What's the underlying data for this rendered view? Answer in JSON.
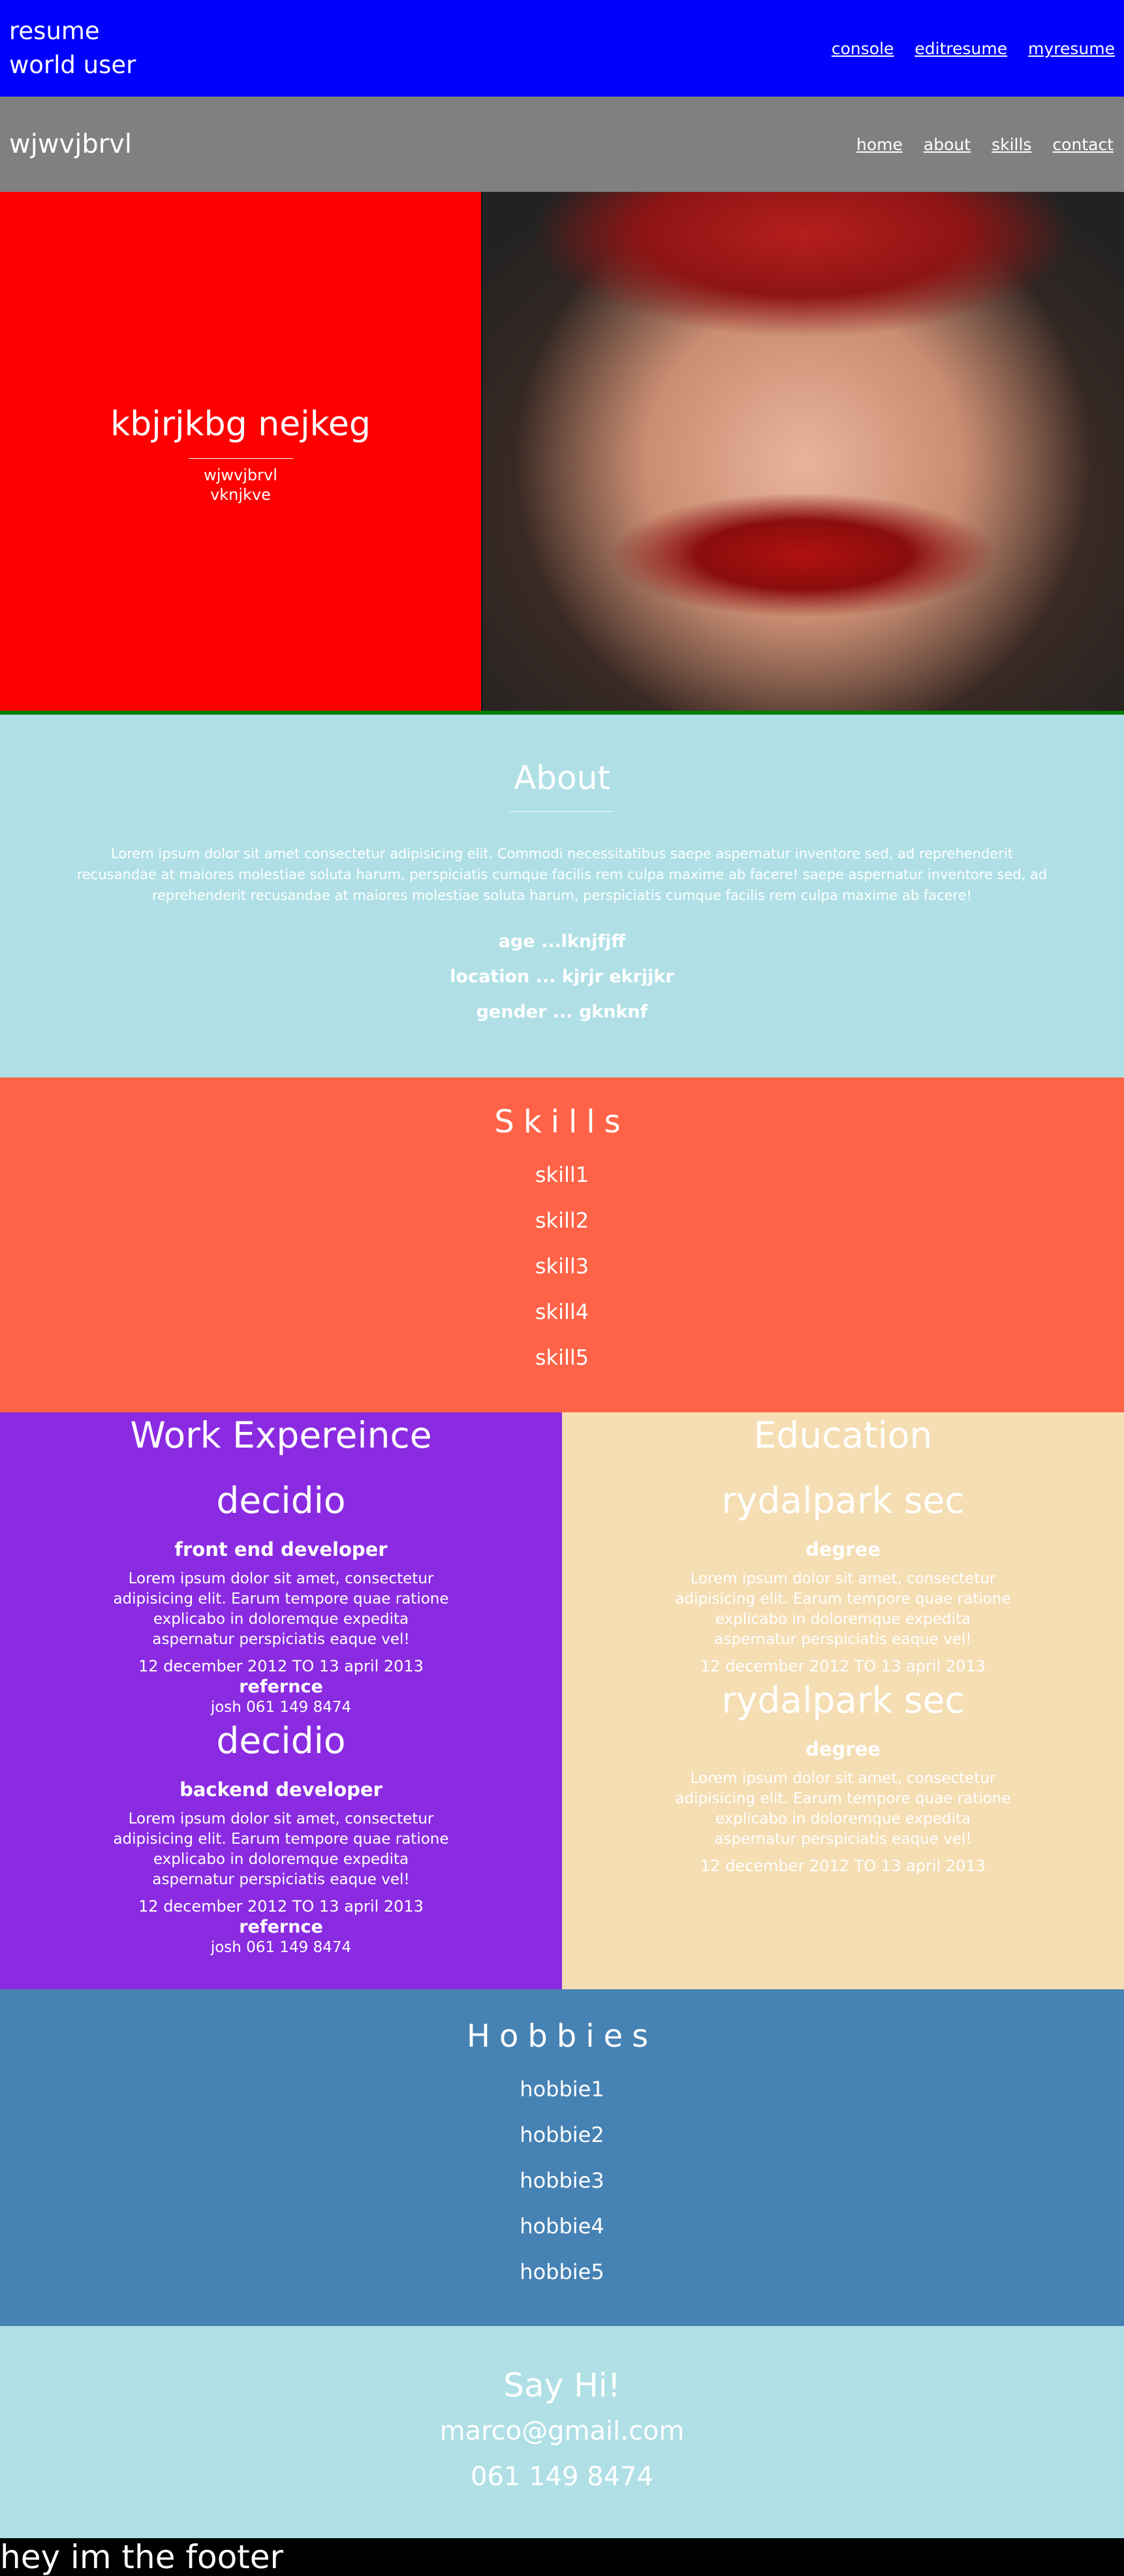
{
  "topbar": {
    "brand_line1": "resume",
    "brand_line2": "world user",
    "links": [
      "console",
      "editresume",
      "myresume"
    ]
  },
  "navbar": {
    "brand": "wjwvjbrvl",
    "links": [
      "home",
      "about",
      "skills",
      "contact"
    ]
  },
  "hero": {
    "name": "kbjrjkbg nejkeg",
    "subtitle_line1": "wjwvjbrvl",
    "subtitle_line2": "vknjkve"
  },
  "about": {
    "title": "About",
    "paragraph": "Lorem ipsum dolor sit amet consectetur adipisicing elit. Commodi necessitatibus saepe aspernatur inventore sed, ad reprehenderit recusandae at maiores molestiae soluta harum, perspiciatis cumque facilis rem culpa maxime ab facere! saepe aspernatur inventore sed, ad reprehenderit recusandae at maiores molestiae soluta harum, perspiciatis cumque facilis rem culpa maxime ab facere!",
    "facts": [
      "age ...lknjfjff",
      "location ... kjrjr ekrjjkr",
      "gender ... gknknf"
    ]
  },
  "skills": {
    "title": "Skills",
    "items": [
      "skill1",
      "skill2",
      "skill3",
      "skill4",
      "skill5"
    ]
  },
  "work": {
    "title": "Work Expereince",
    "entries": [
      {
        "org": "decidio",
        "role": "front end developer",
        "desc": "Lorem ipsum dolor sit amet, consectetur adipisicing elit. Earum tempore quae ratione explicabo in doloremque expedita aspernatur perspiciatis eaque vel!",
        "dates": "12 december 2012 TO 13 april 2013",
        "ref_label": "refernce",
        "ref": "josh 061 149 8474"
      },
      {
        "org": "decidio",
        "role": "backend developer",
        "desc": "Lorem ipsum dolor sit amet, consectetur adipisicing elit. Earum tempore quae ratione explicabo in doloremque expedita aspernatur perspiciatis eaque vel!",
        "dates": "12 december 2012 TO 13 april 2013",
        "ref_label": "refernce",
        "ref": "josh 061 149 8474"
      }
    ]
  },
  "education": {
    "title": "Education",
    "entries": [
      {
        "org": "rydalpark sec",
        "role": "degree",
        "desc": "Lorem ipsum dolor sit amet, consectetur adipisicing elit. Earum tempore quae ratione explicabo in doloremque expedita aspernatur perspiciatis eaque vel!",
        "dates": "12 december 2012 TO 13 april 2013"
      },
      {
        "org": "rydalpark sec",
        "role": "degree",
        "desc": "Lorem ipsum dolor sit amet, consectetur adipisicing elit. Earum tempore quae ratione explicabo in doloremque expedita aspernatur perspiciatis eaque vel!",
        "dates": "12 december 2012 TO 13 april 2013"
      }
    ]
  },
  "hobbies": {
    "title": "Hobbies",
    "items": [
      "hobbie1",
      "hobbie2",
      "hobbie3",
      "hobbie4",
      "hobbie5"
    ]
  },
  "contact": {
    "title": "Say Hi!",
    "email": "marco@gmail.com",
    "phone": "061 149 8474"
  },
  "footer": {
    "text": "hey im the footer"
  },
  "colors": {
    "topbar": "#0000ff",
    "navbar": "#808080",
    "hero_left": "#ff0000",
    "hero_border": "#008000",
    "about": "#b0e0e6",
    "skills": "#ff6347",
    "work": "#8a2be2",
    "education": "#f5deb3",
    "hobbies": "#4682b4",
    "contact": "#b0e0e6",
    "footer": "#000000"
  }
}
